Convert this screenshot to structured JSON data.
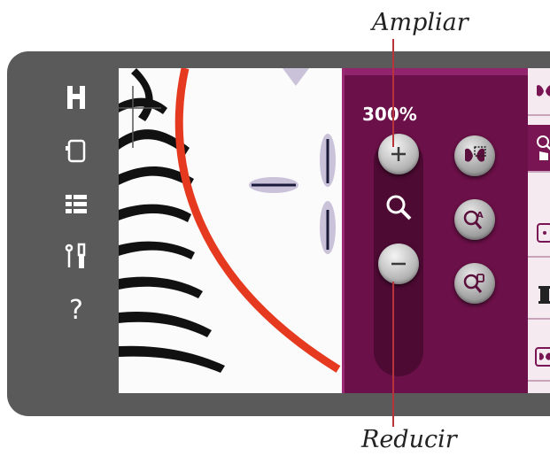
{
  "callouts": {
    "top": "Ampliar",
    "bottom": "Reducir"
  },
  "sidebar": {
    "items": [
      {
        "icon": "presser-foot-icon"
      },
      {
        "icon": "machine-mode-icon"
      },
      {
        "icon": "menu-grid-icon"
      },
      {
        "icon": "tools-icon"
      },
      {
        "icon": "help-icon",
        "label": "?"
      }
    ]
  },
  "zoom": {
    "level": "300%",
    "zoom_in_icon": "plus-icon",
    "zoom_center_icon": "magnifier-icon",
    "zoom_out_icon": "minus-icon",
    "zoom_to_box_icon": "zoom-box-icon",
    "zoom_all_icon": "zoom-all-icon",
    "zoom_to_hoop_icon": "zoom-hoop-icon"
  },
  "right_strip": {
    "items": [
      "design-icon",
      "zoom-pan-icon",
      "position-icon",
      "thread-spool-icon",
      "embroidery-icon"
    ]
  },
  "colors": {
    "panel_bg": "#6b1048",
    "accent": "#92246d",
    "frame": "#5a5a5a",
    "red_stitch": "#e53a1f"
  }
}
